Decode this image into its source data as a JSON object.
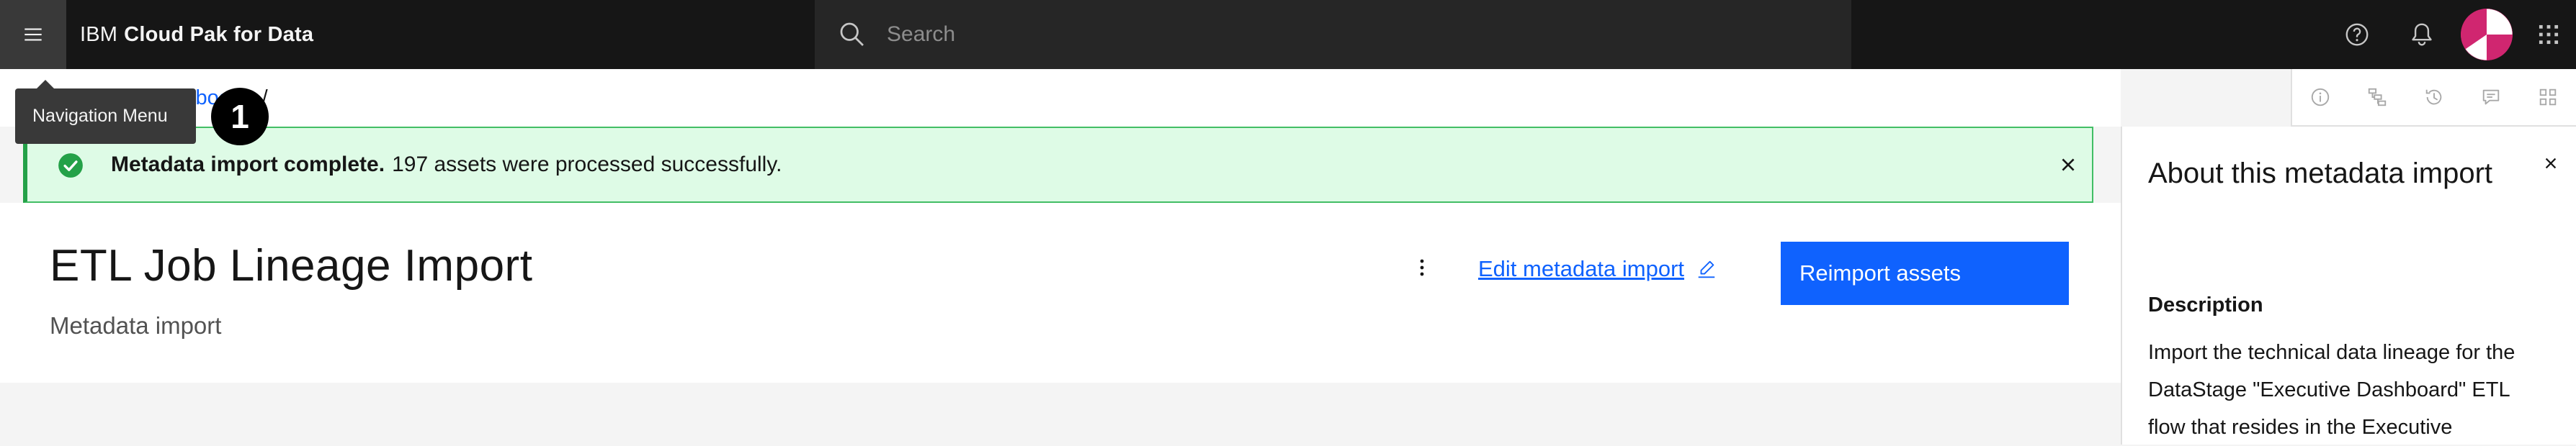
{
  "header": {
    "brand_prefix": "IBM",
    "brand_name": "Cloud Pak for Data",
    "search_placeholder": "Search",
    "menu_icon": "menu-icon",
    "help_icon": "help-icon",
    "notification_icon": "notification-icon",
    "switcher_icon": "app-switcher-icon"
  },
  "tooltip": {
    "label": "Navigation Menu"
  },
  "step_badge": "1",
  "breadcrumb": {
    "items": [
      "Executive Dashboard"
    ],
    "separator": "/"
  },
  "notification": {
    "title": "Metadata import complete.",
    "message": "197 assets were processed successfully."
  },
  "main": {
    "title": "ETL Job Lineage Import",
    "subtitle": "Metadata import",
    "edit_label": "Edit metadata import",
    "primary_label": "Reimport assets"
  },
  "side_panel": {
    "title": "About this metadata import",
    "description_label": "Description",
    "description": "Import the technical data lineage for the DataStage \"Executive Dashboard\" ETL flow that resides in the Executive"
  },
  "colors": {
    "accent": "#0f62fe",
    "success": "#24a148",
    "header_bg": "#161616"
  }
}
